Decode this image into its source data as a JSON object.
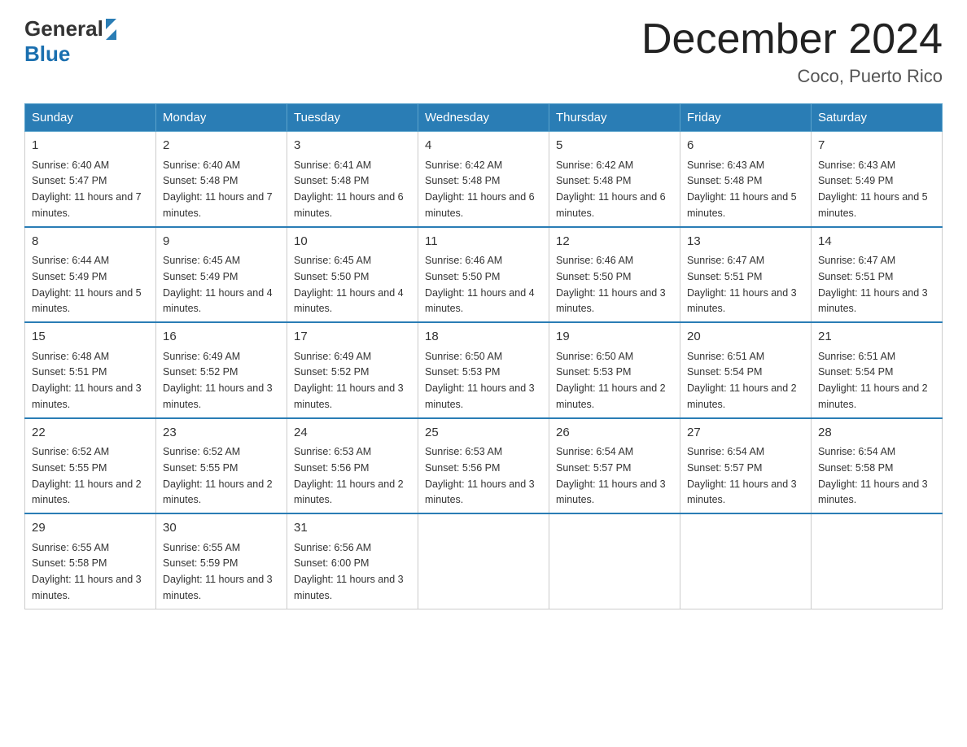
{
  "logo": {
    "text_general": "General",
    "text_blue": "Blue"
  },
  "title": "December 2024",
  "subtitle": "Coco, Puerto Rico",
  "days_of_week": [
    "Sunday",
    "Monday",
    "Tuesday",
    "Wednesday",
    "Thursday",
    "Friday",
    "Saturday"
  ],
  "weeks": [
    [
      {
        "day": "1",
        "sunrise": "6:40 AM",
        "sunset": "5:47 PM",
        "daylight": "11 hours and 7 minutes."
      },
      {
        "day": "2",
        "sunrise": "6:40 AM",
        "sunset": "5:48 PM",
        "daylight": "11 hours and 7 minutes."
      },
      {
        "day": "3",
        "sunrise": "6:41 AM",
        "sunset": "5:48 PM",
        "daylight": "11 hours and 6 minutes."
      },
      {
        "day": "4",
        "sunrise": "6:42 AM",
        "sunset": "5:48 PM",
        "daylight": "11 hours and 6 minutes."
      },
      {
        "day": "5",
        "sunrise": "6:42 AM",
        "sunset": "5:48 PM",
        "daylight": "11 hours and 6 minutes."
      },
      {
        "day": "6",
        "sunrise": "6:43 AM",
        "sunset": "5:48 PM",
        "daylight": "11 hours and 5 minutes."
      },
      {
        "day": "7",
        "sunrise": "6:43 AM",
        "sunset": "5:49 PM",
        "daylight": "11 hours and 5 minutes."
      }
    ],
    [
      {
        "day": "8",
        "sunrise": "6:44 AM",
        "sunset": "5:49 PM",
        "daylight": "11 hours and 5 minutes."
      },
      {
        "day": "9",
        "sunrise": "6:45 AM",
        "sunset": "5:49 PM",
        "daylight": "11 hours and 4 minutes."
      },
      {
        "day": "10",
        "sunrise": "6:45 AM",
        "sunset": "5:50 PM",
        "daylight": "11 hours and 4 minutes."
      },
      {
        "day": "11",
        "sunrise": "6:46 AM",
        "sunset": "5:50 PM",
        "daylight": "11 hours and 4 minutes."
      },
      {
        "day": "12",
        "sunrise": "6:46 AM",
        "sunset": "5:50 PM",
        "daylight": "11 hours and 3 minutes."
      },
      {
        "day": "13",
        "sunrise": "6:47 AM",
        "sunset": "5:51 PM",
        "daylight": "11 hours and 3 minutes."
      },
      {
        "day": "14",
        "sunrise": "6:47 AM",
        "sunset": "5:51 PM",
        "daylight": "11 hours and 3 minutes."
      }
    ],
    [
      {
        "day": "15",
        "sunrise": "6:48 AM",
        "sunset": "5:51 PM",
        "daylight": "11 hours and 3 minutes."
      },
      {
        "day": "16",
        "sunrise": "6:49 AM",
        "sunset": "5:52 PM",
        "daylight": "11 hours and 3 minutes."
      },
      {
        "day": "17",
        "sunrise": "6:49 AM",
        "sunset": "5:52 PM",
        "daylight": "11 hours and 3 minutes."
      },
      {
        "day": "18",
        "sunrise": "6:50 AM",
        "sunset": "5:53 PM",
        "daylight": "11 hours and 3 minutes."
      },
      {
        "day": "19",
        "sunrise": "6:50 AM",
        "sunset": "5:53 PM",
        "daylight": "11 hours and 2 minutes."
      },
      {
        "day": "20",
        "sunrise": "6:51 AM",
        "sunset": "5:54 PM",
        "daylight": "11 hours and 2 minutes."
      },
      {
        "day": "21",
        "sunrise": "6:51 AM",
        "sunset": "5:54 PM",
        "daylight": "11 hours and 2 minutes."
      }
    ],
    [
      {
        "day": "22",
        "sunrise": "6:52 AM",
        "sunset": "5:55 PM",
        "daylight": "11 hours and 2 minutes."
      },
      {
        "day": "23",
        "sunrise": "6:52 AM",
        "sunset": "5:55 PM",
        "daylight": "11 hours and 2 minutes."
      },
      {
        "day": "24",
        "sunrise": "6:53 AM",
        "sunset": "5:56 PM",
        "daylight": "11 hours and 2 minutes."
      },
      {
        "day": "25",
        "sunrise": "6:53 AM",
        "sunset": "5:56 PM",
        "daylight": "11 hours and 3 minutes."
      },
      {
        "day": "26",
        "sunrise": "6:54 AM",
        "sunset": "5:57 PM",
        "daylight": "11 hours and 3 minutes."
      },
      {
        "day": "27",
        "sunrise": "6:54 AM",
        "sunset": "5:57 PM",
        "daylight": "11 hours and 3 minutes."
      },
      {
        "day": "28",
        "sunrise": "6:54 AM",
        "sunset": "5:58 PM",
        "daylight": "11 hours and 3 minutes."
      }
    ],
    [
      {
        "day": "29",
        "sunrise": "6:55 AM",
        "sunset": "5:58 PM",
        "daylight": "11 hours and 3 minutes."
      },
      {
        "day": "30",
        "sunrise": "6:55 AM",
        "sunset": "5:59 PM",
        "daylight": "11 hours and 3 minutes."
      },
      {
        "day": "31",
        "sunrise": "6:56 AM",
        "sunset": "6:00 PM",
        "daylight": "11 hours and 3 minutes."
      },
      null,
      null,
      null,
      null
    ]
  ]
}
